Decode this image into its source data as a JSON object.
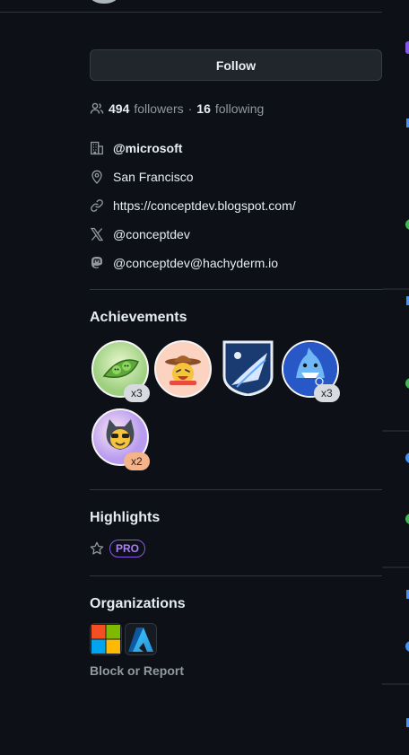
{
  "follow": {
    "label": "Follow"
  },
  "stats": {
    "followers_count": "494",
    "followers_label": "followers",
    "following_count": "16",
    "following_label": "following"
  },
  "vcard": {
    "org": "@microsoft",
    "location": "San Francisco",
    "website": "https://conceptdev.blogspot.com/",
    "x_handle": "@conceptdev",
    "mastodon": "@conceptdev@hachyderm.io"
  },
  "achievements": {
    "title": "Achievements",
    "badges": [
      {
        "icon": "pair-extraordinaire-icon",
        "multiplier": "x3"
      },
      {
        "icon": "yolo-cowboy-icon",
        "multiplier": ""
      },
      {
        "icon": "starstruck-mountain-icon",
        "multiplier": ""
      },
      {
        "icon": "shark-icon",
        "multiplier": "x3"
      },
      {
        "icon": "cool-cat-icon",
        "multiplier": "x2"
      }
    ]
  },
  "highlights": {
    "title": "Highlights",
    "pro_label": "PRO"
  },
  "organizations": {
    "title": "Organizations",
    "items": [
      {
        "icon": "microsoft-logo-icon"
      },
      {
        "icon": "azure-logo-icon"
      }
    ]
  },
  "block_report": "Block or Report",
  "colors": {
    "background": "#0d1117",
    "border": "#30363d",
    "muted": "#9198a1",
    "pro_purple": "#ab7df8",
    "text": "#e6edf3"
  }
}
